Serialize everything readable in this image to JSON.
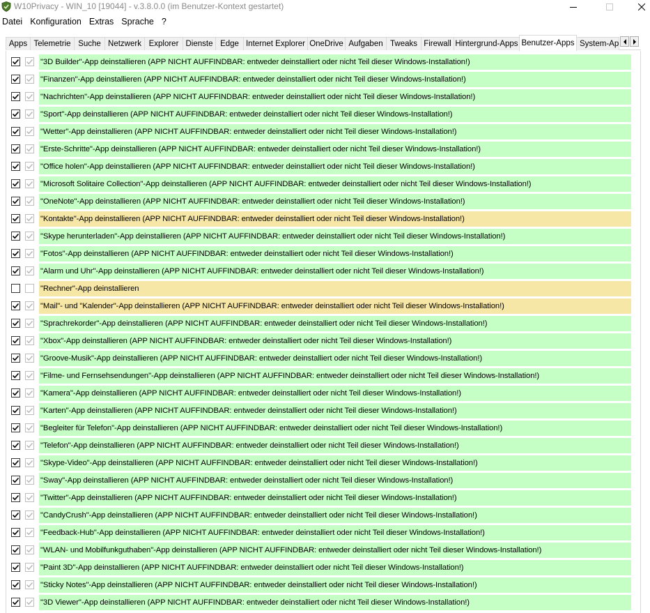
{
  "window": {
    "title": "W10Privacy - WIN_10 [19044]  - v.3.8.0.0 (im Benutzer-Kontext gestartet)",
    "colors": {
      "green": "#c6ffc6",
      "yellow": "#f7e7a6"
    }
  },
  "menu": [
    "Datei",
    "Konfiguration",
    "Extras",
    "Sprache",
    "?"
  ],
  "tabs": [
    "Apps",
    "Telemetrie",
    "Suche",
    "Netzwerk",
    "Explorer",
    "Dienste",
    "Edge",
    "Internet Explorer",
    "OneDrive",
    "Aufgaben",
    "Tweaks",
    "Firewall",
    "Hintergrund-Apps",
    "Benutzer-Apps",
    "System-App"
  ],
  "active_tab": "Benutzer-Apps",
  "rows": [
    {
      "label": "\"3D Builder\"-App deinstallieren (APP NICHT AUFFINDBAR: entweder deinstalliert oder nicht Teil dieser Windows-Installation!)",
      "checked": true,
      "status": "green"
    },
    {
      "label": "\"Finanzen\"-App deinstallieren (APP NICHT AUFFINDBAR: entweder deinstalliert oder nicht Teil dieser Windows-Installation!)",
      "checked": true,
      "status": "green"
    },
    {
      "label": "\"Nachrichten\"-App deinstallieren (APP NICHT AUFFINDBAR: entweder deinstalliert oder nicht Teil dieser Windows-Installation!)",
      "checked": true,
      "status": "green"
    },
    {
      "label": "\"Sport\"-App deinstallieren (APP NICHT AUFFINDBAR: entweder deinstalliert oder nicht Teil dieser Windows-Installation!)",
      "checked": true,
      "status": "green"
    },
    {
      "label": "\"Wetter\"-App deinstallieren (APP NICHT AUFFINDBAR: entweder deinstalliert oder nicht Teil dieser Windows-Installation!)",
      "checked": true,
      "status": "green"
    },
    {
      "label": "\"Erste-Schritte\"-App deinstallieren (APP NICHT AUFFINDBAR: entweder deinstalliert oder nicht Teil dieser Windows-Installation!)",
      "checked": true,
      "status": "green"
    },
    {
      "label": "\"Office holen\"-App deinstallieren (APP NICHT AUFFINDBAR: entweder deinstalliert oder nicht Teil dieser Windows-Installation!)",
      "checked": true,
      "status": "green"
    },
    {
      "label": "\"Microsoft Solitaire Collection\"-App deinstallieren (APP NICHT AUFFINDBAR: entweder deinstalliert oder nicht Teil dieser Windows-Installation!)",
      "checked": true,
      "status": "green"
    },
    {
      "label": "\"OneNote\"-App deinstallieren (APP NICHT AUFFINDBAR: entweder deinstalliert oder nicht Teil dieser Windows-Installation!)",
      "checked": true,
      "status": "green"
    },
    {
      "label": "\"Kontakte\"-App deinstallieren (APP NICHT AUFFINDBAR: entweder deinstalliert oder nicht Teil dieser Windows-Installation!)",
      "checked": true,
      "status": "yellow"
    },
    {
      "label": "\"Skype herunterladen\"-App deinstallieren (APP NICHT AUFFINDBAR: entweder deinstalliert oder nicht Teil dieser Windows-Installation!)",
      "checked": true,
      "status": "green"
    },
    {
      "label": "\"Fotos\"-App deinstallieren (APP NICHT AUFFINDBAR: entweder deinstalliert oder nicht Teil dieser Windows-Installation!)",
      "checked": true,
      "status": "green"
    },
    {
      "label": "\"Alarm und Uhr\"-App deinstallieren (APP NICHT AUFFINDBAR: entweder deinstalliert oder nicht Teil dieser Windows-Installation!)",
      "checked": true,
      "status": "green"
    },
    {
      "label": "\"Rechner\"-App deinstallieren",
      "checked": false,
      "status": "yellow"
    },
    {
      "label": "\"Mail\"- und \"Kalender\"-App deinstallieren (APP NICHT AUFFINDBAR: entweder deinstalliert oder nicht Teil dieser Windows-Installation!)",
      "checked": true,
      "status": "yellow"
    },
    {
      "label": "\"Sprachrekorder\"-App deinstallieren (APP NICHT AUFFINDBAR: entweder deinstalliert oder nicht Teil dieser Windows-Installation!)",
      "checked": true,
      "status": "green"
    },
    {
      "label": "\"Xbox\"-App deinstallieren (APP NICHT AUFFINDBAR: entweder deinstalliert oder nicht Teil dieser Windows-Installation!)",
      "checked": true,
      "status": "green"
    },
    {
      "label": "\"Groove-Musik\"-App deinstallieren (APP NICHT AUFFINDBAR: entweder deinstalliert oder nicht Teil dieser Windows-Installation!)",
      "checked": true,
      "status": "green"
    },
    {
      "label": "\"Filme- und Fernsehsendungen\"-App deinstallieren (APP NICHT AUFFINDBAR: entweder deinstalliert oder nicht Teil dieser Windows-Installation!)",
      "checked": true,
      "status": "green"
    },
    {
      "label": "\"Kamera\"-App deinstallieren (APP NICHT AUFFINDBAR: entweder deinstalliert oder nicht Teil dieser Windows-Installation!)",
      "checked": true,
      "status": "green"
    },
    {
      "label": "\"Karten\"-App deinstallieren (APP NICHT AUFFINDBAR: entweder deinstalliert oder nicht Teil dieser Windows-Installation!)",
      "checked": true,
      "status": "green"
    },
    {
      "label": "\"Begleiter für Telefon\"-App deinstallieren (APP NICHT AUFFINDBAR: entweder deinstalliert oder nicht Teil dieser Windows-Installation!)",
      "checked": true,
      "status": "green"
    },
    {
      "label": "\"Telefon\"-App deinstallieren (APP NICHT AUFFINDBAR: entweder deinstalliert oder nicht Teil dieser Windows-Installation!)",
      "checked": true,
      "status": "green"
    },
    {
      "label": "\"Skype-Video\"-App deinstallieren (APP NICHT AUFFINDBAR: entweder deinstalliert oder nicht Teil dieser Windows-Installation!)",
      "checked": true,
      "status": "green"
    },
    {
      "label": "\"Sway\"-App deinstallieren (APP NICHT AUFFINDBAR: entweder deinstalliert oder nicht Teil dieser Windows-Installation!)",
      "checked": true,
      "status": "green"
    },
    {
      "label": "\"Twitter\"-App deinstallieren (APP NICHT AUFFINDBAR: entweder deinstalliert oder nicht Teil dieser Windows-Installation!)",
      "checked": true,
      "status": "green"
    },
    {
      "label": "\"CandyCrush\"-App deinstallieren (APP NICHT AUFFINDBAR: entweder deinstalliert oder nicht Teil dieser Windows-Installation!)",
      "checked": true,
      "status": "green"
    },
    {
      "label": "\"Feedback-Hub\"-App deinstallieren (APP NICHT AUFFINDBAR: entweder deinstalliert oder nicht Teil dieser Windows-Installation!)",
      "checked": true,
      "status": "green"
    },
    {
      "label": "\"WLAN- und Mobilfunkguthaben\"-App deinstallieren (APP NICHT AUFFINDBAR: entweder deinstalliert oder nicht Teil dieser Windows-Installation!)",
      "checked": true,
      "status": "green"
    },
    {
      "label": "\"Paint 3D\"-App deinstallieren (APP NICHT AUFFINDBAR: entweder deinstalliert oder nicht Teil dieser Windows-Installation!)",
      "checked": true,
      "status": "green"
    },
    {
      "label": "\"Sticky Notes\"-App deinstallieren (APP NICHT AUFFINDBAR: entweder deinstalliert oder nicht Teil dieser Windows-Installation!)",
      "checked": true,
      "status": "green"
    },
    {
      "label": "\"3D Viewer\"-App deinstallieren (APP NICHT AUFFINDBAR: entweder deinstalliert oder nicht Teil dieser Windows-Installation!)",
      "checked": true,
      "status": "green"
    }
  ]
}
